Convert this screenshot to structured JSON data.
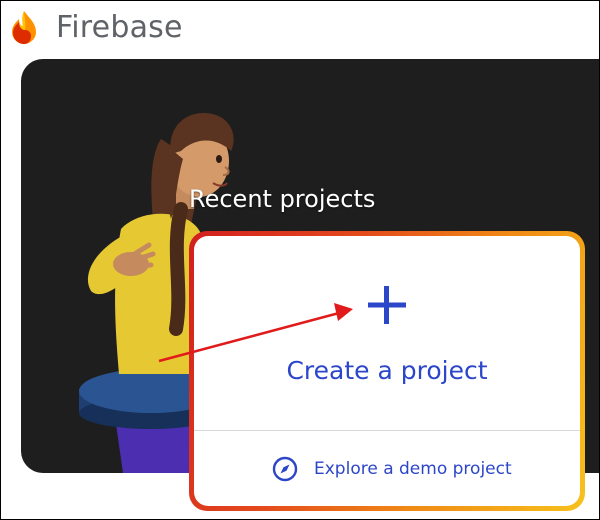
{
  "app": {
    "name": "Firebase"
  },
  "recent_projects": {
    "title": "Recent projects"
  },
  "create_card": {
    "label": "Create a project",
    "icon": "plus-icon"
  },
  "explore": {
    "label": "Explore a demo project",
    "icon": "compass-icon"
  },
  "colors": {
    "accent_blue": "#2c46c9",
    "annotation_red": "#e11b1b",
    "hero_background": "#1e1e1e",
    "card_border_start": "#d21f1f",
    "card_border_end": "#f7c21c"
  }
}
